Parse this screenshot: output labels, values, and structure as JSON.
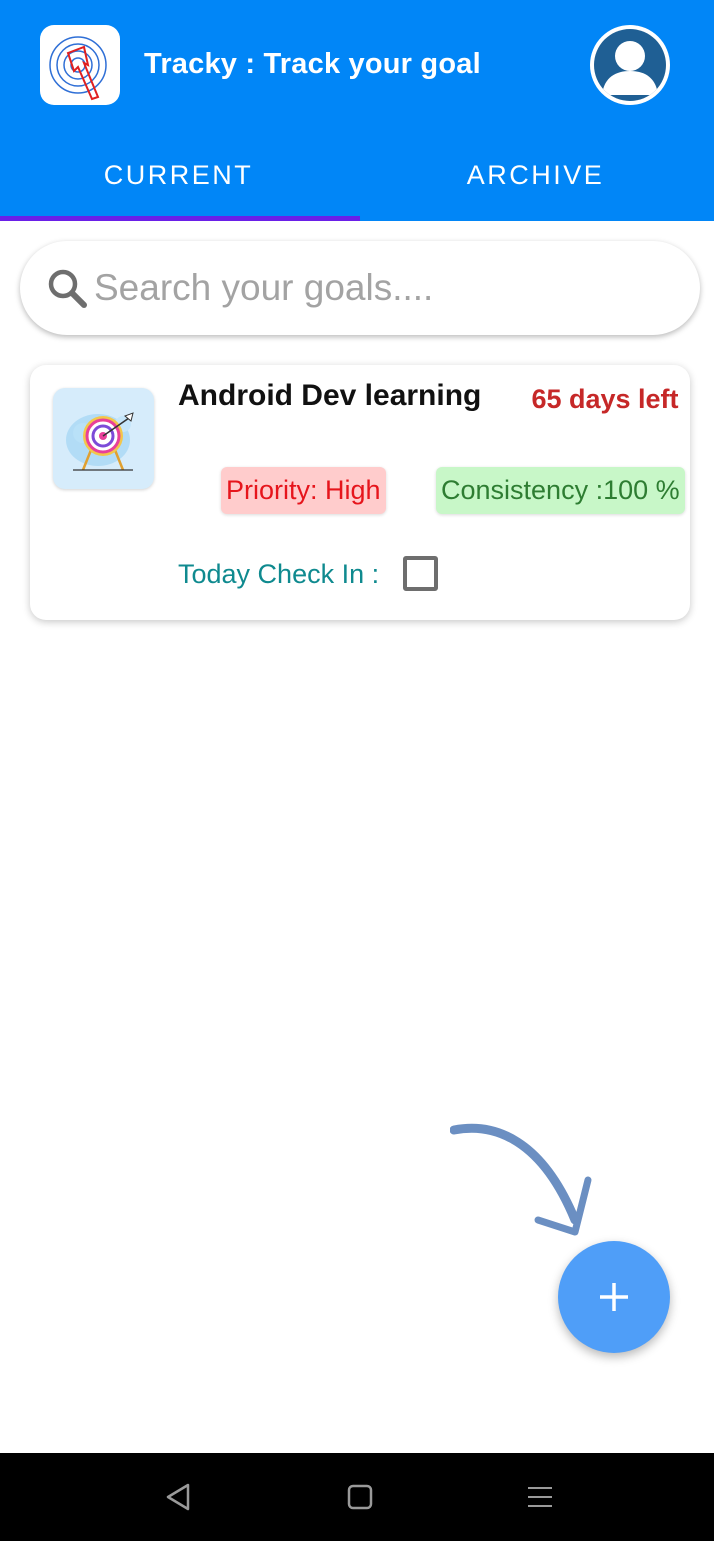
{
  "header": {
    "title": "Tracky : Track your goal",
    "logo_icon": "target-arrow-logo-icon",
    "profile_icon": "user-avatar-icon"
  },
  "tabs": [
    {
      "label": "CURRENT",
      "selected": true
    },
    {
      "label": "ARCHIVE",
      "selected": false
    }
  ],
  "search": {
    "placeholder": "Search your goals....",
    "value": "",
    "icon": "search-icon"
  },
  "goals": [
    {
      "title": "Android Dev learning",
      "days_left": "65 days left",
      "priority": "Priority: High",
      "consistency": "Consistency :100 %",
      "checkin_label": "Today Check In :",
      "checked_in": false,
      "image_icon": "archery-target-icon"
    }
  ],
  "fab": {
    "icon": "plus-icon"
  },
  "nav_bar": {
    "icons": [
      "back-icon",
      "home-icon",
      "recents-icon"
    ]
  },
  "colors": {
    "primary": "#0186f7",
    "tab_indicator": "#6a1fe8",
    "fab": "#4f9ef8",
    "days_left": "#c62828",
    "priority_bg": "#ffcccc",
    "priority_text": "#e6151c",
    "consistency_bg": "#c8f7c8",
    "consistency_text": "#2e7d32",
    "checkin_text": "#0f8a8f"
  }
}
